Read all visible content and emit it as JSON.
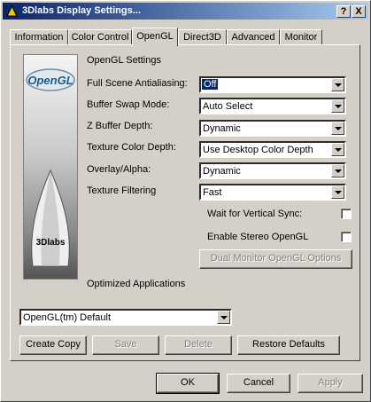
{
  "window": {
    "title": "3Dlabs Display Settings...",
    "help_btn": "?",
    "close_btn": "X"
  },
  "tabs": [
    "Information",
    "Color Control",
    "OpenGL",
    "Direct3D",
    "Advanced",
    "Monitor"
  ],
  "opengl": {
    "section_title": "OpenGL Settings",
    "logo_text": "OpenGL",
    "brand_text": "3Dlabs",
    "settings": [
      {
        "label": "Full Scene Antialiasing:",
        "value": "Off"
      },
      {
        "label": "Buffer Swap Mode:",
        "value": "Auto Select"
      },
      {
        "label": "Z Buffer Depth:",
        "value": "Dynamic"
      },
      {
        "label": "Texture Color Depth:",
        "value": "Use Desktop Color Depth"
      },
      {
        "label": "Overlay/Alpha:",
        "value": "Dynamic"
      },
      {
        "label": "Texture Filtering",
        "value": "Fast"
      }
    ],
    "wait_vsync_label": "Wait for Vertical Sync:",
    "stereo_label": "Enable Stereo OpenGL",
    "dual_monitor_btn": "Dual Monitor OpenGL Options",
    "optimized_title": "Optimized Applications",
    "app_selected": "OpenGL(tm) Default",
    "create_copy": "Create Copy",
    "save": "Save",
    "delete": "Delete",
    "restore_defaults": "Restore Defaults"
  },
  "footer": {
    "ok": "OK",
    "cancel": "Cancel",
    "apply": "Apply"
  }
}
